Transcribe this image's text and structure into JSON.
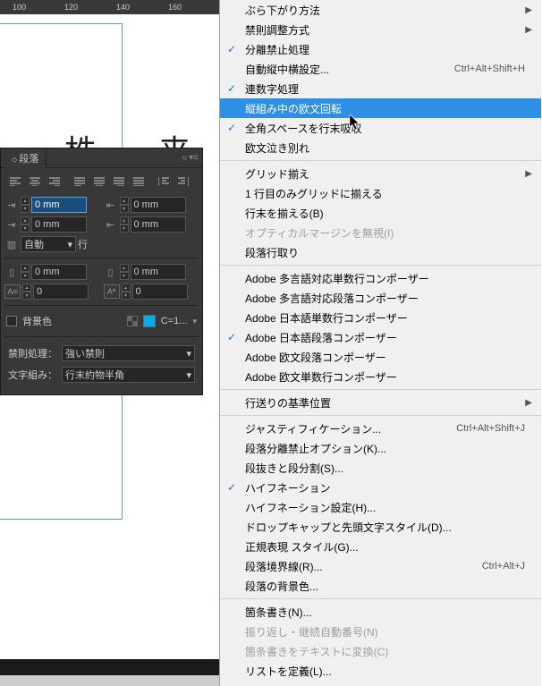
{
  "ruler": {
    "ticks": [
      "100",
      "120",
      "140",
      "160"
    ]
  },
  "cjk_text": "株 来",
  "panel": {
    "title": "段落",
    "indent_left": "0 mm",
    "indent_right": "0 mm",
    "indent_first": "0 mm",
    "indent_first2": "0 mm",
    "indent_first3": "0 mm",
    "dropcap_auto": "自動",
    "dropcap_unit": "行",
    "space_before": "0 mm",
    "space_after": "0 mm",
    "dropcap_lines": "0",
    "dropcap_chars": "0",
    "bgcolor_label": "背景色",
    "swatch_label": "C=1...",
    "kinsoku_label": "禁則処理：",
    "kinsoku_value": "強い禁則",
    "mojikumi_label": "文字組み：",
    "mojikumi_value": "行末約物半角"
  },
  "menu": {
    "items": [
      {
        "label": "ぶら下がり方法",
        "submenu": true
      },
      {
        "label": "禁則調整方式",
        "submenu": true
      },
      {
        "label": "分離禁止処理",
        "checked": true
      },
      {
        "label": "自動縦中横設定...",
        "shortcut": "Ctrl+Alt+Shift+H"
      },
      {
        "label": "連数字処理",
        "checked": true
      },
      {
        "label": "縦組み中の欧文回転",
        "highlight": true
      },
      {
        "label": "全角スペースを行末吸収",
        "checked": true
      },
      {
        "label": "欧文泣き別れ"
      },
      {
        "sep": true
      },
      {
        "label": "グリッド揃え",
        "submenu": true
      },
      {
        "label": "1 行目のみグリッドに揃える"
      },
      {
        "label": "行末を揃える(B)"
      },
      {
        "label": "オプティカルマージンを無視(I)",
        "disabled": true
      },
      {
        "label": "段落行取り"
      },
      {
        "sep": true
      },
      {
        "label": "Adobe 多言語対応単数行コンポーザー"
      },
      {
        "label": "Adobe 多言語対応段落コンポーザー"
      },
      {
        "label": "Adobe 日本語単数行コンポーザー"
      },
      {
        "label": "Adobe 日本語段落コンポーザー",
        "checked": true
      },
      {
        "label": "Adobe 欧文段落コンポーザー"
      },
      {
        "label": "Adobe 欧文単数行コンポーザー"
      },
      {
        "sep": true
      },
      {
        "label": "行送りの基準位置",
        "submenu": true
      },
      {
        "sep": true
      },
      {
        "label": "ジャスティフィケーション...",
        "shortcut": "Ctrl+Alt+Shift+J"
      },
      {
        "label": "段落分離禁止オプション(K)..."
      },
      {
        "label": "段抜きと段分割(S)..."
      },
      {
        "label": "ハイフネーション",
        "checked": true
      },
      {
        "label": "ハイフネーション設定(H)..."
      },
      {
        "label": "ドロップキャップと先頭文字スタイル(D)..."
      },
      {
        "label": "正規表現 スタイル(G)..."
      },
      {
        "label": "段落境界線(R)...",
        "shortcut": "Ctrl+Alt+J"
      },
      {
        "label": "段落の背景色..."
      },
      {
        "sep": true
      },
      {
        "label": "箇条書き(N)..."
      },
      {
        "label": "振り返し・継続自動番号(N)",
        "disabled": true
      },
      {
        "label": "箇条書きをテキストに変換(C)",
        "disabled": true
      },
      {
        "label": "リストを定義(L)..."
      }
    ]
  }
}
